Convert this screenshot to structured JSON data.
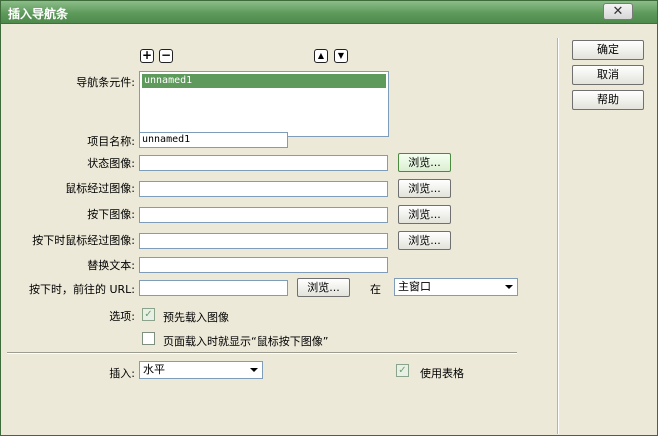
{
  "window": {
    "title": "插入导航条",
    "close_glyph": "✕"
  },
  "elements_label": "导航条元件:",
  "add_glyph": "+",
  "remove_glyph": "−",
  "up_glyph": "▲",
  "down_glyph": "▼",
  "elements_list": [
    "unnamed1"
  ],
  "item_name": {
    "label": "项目名称:",
    "value": "unnamed1"
  },
  "state_image": {
    "label": "状态图像:",
    "value": "",
    "browse": "浏览..."
  },
  "rollover_image": {
    "label": "鼠标经过图像:",
    "value": "",
    "browse": "浏览..."
  },
  "down_image": {
    "label": "按下图像:",
    "value": "",
    "browse": "浏览..."
  },
  "over_while_down": {
    "label": "按下时鼠标经过图像:",
    "value": "",
    "browse": "浏览..."
  },
  "alt_text": {
    "label": "替换文本:",
    "value": ""
  },
  "down_url": {
    "label": "按下时，前往的 URL:",
    "value": "",
    "browse": "浏览...",
    "in_label": "在",
    "target": "主窗口"
  },
  "options": {
    "label": "选项:",
    "preload": "预先载入图像",
    "show_down": "页面载入时就显示“鼠标按下图像”"
  },
  "insert": {
    "label": "插入:",
    "value": "水平"
  },
  "use_table": "使用表格",
  "buttons": {
    "ok": "确定",
    "cancel": "取消",
    "help": "帮助"
  }
}
